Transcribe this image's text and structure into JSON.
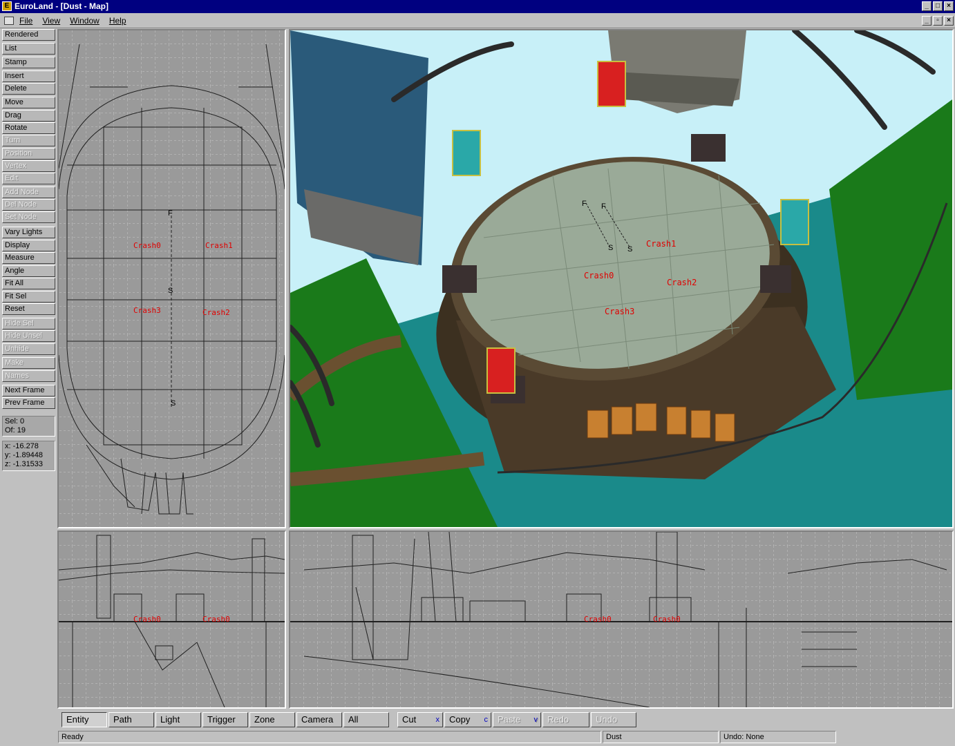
{
  "window": {
    "title": "EuroLand - [Dust - Map]",
    "app_icon": "E",
    "controls": [
      "minimize-icon",
      "maximize-icon",
      "close-icon"
    ]
  },
  "menu": {
    "items": [
      "File",
      "View",
      "Window",
      "Help"
    ]
  },
  "toolbar": {
    "buttons": [
      {
        "label": "Rendered",
        "enabled": true
      },
      {
        "label": "List",
        "enabled": true
      },
      {
        "label": "Stamp",
        "enabled": true
      },
      {
        "label": "Insert",
        "enabled": true
      },
      {
        "label": "Delete",
        "enabled": true
      },
      {
        "label": "Move",
        "enabled": true
      },
      {
        "label": "Drag",
        "enabled": true
      },
      {
        "label": "Rotate",
        "enabled": true
      },
      {
        "label": "Turn",
        "enabled": false
      },
      {
        "label": "Position",
        "enabled": false
      },
      {
        "label": "Vertex",
        "enabled": false
      },
      {
        "label": "Edit",
        "enabled": false
      },
      {
        "label": "Add Node",
        "enabled": false
      },
      {
        "label": "Del Node",
        "enabled": false
      },
      {
        "label": "Set Node",
        "enabled": false
      },
      {
        "label": "Vary Lights",
        "enabled": true
      },
      {
        "label": "Display",
        "enabled": true
      },
      {
        "label": "Measure",
        "enabled": true
      },
      {
        "label": "Angle",
        "enabled": true
      },
      {
        "label": "Fit All",
        "enabled": true
      },
      {
        "label": "Fit Sel",
        "enabled": true
      },
      {
        "label": "Reset",
        "enabled": true
      },
      {
        "label": "Hide Sel",
        "enabled": false
      },
      {
        "label": "Hide Unsel",
        "enabled": false
      },
      {
        "label": "Unhide",
        "enabled": false
      },
      {
        "label": "Make",
        "enabled": false
      },
      {
        "label": "Names",
        "enabled": false
      },
      {
        "label": "Next Frame",
        "enabled": true
      },
      {
        "label": "Prev Frame",
        "enabled": true
      }
    ],
    "selection": {
      "sel": "Sel: 0",
      "of": "Of: 19"
    },
    "coords": {
      "x": "x: -16.278",
      "y": "y: -1.89448",
      "z": "z: -1.31533"
    }
  },
  "viewports": {
    "top": {
      "labels": [
        "Crash0",
        "Crash1",
        "Crash3",
        "Crash2"
      ],
      "path_markers": [
        "F",
        "S",
        "S"
      ]
    },
    "perspective": {
      "labels": [
        "Crash1",
        "Crash0",
        "Crash2",
        "Crash3"
      ],
      "path_markers": [
        "F",
        "F",
        "S",
        "S"
      ]
    },
    "front": {
      "labels": [
        "Crash0",
        "Crash0"
      ]
    },
    "side": {
      "labels": [
        "Crash0",
        "Crash0"
      ]
    }
  },
  "tabs": [
    {
      "label": "Entity",
      "selected": true,
      "enabled": true,
      "key": ""
    },
    {
      "label": "Path",
      "selected": false,
      "enabled": true,
      "key": ""
    },
    {
      "label": "Light",
      "selected": false,
      "enabled": true,
      "key": ""
    },
    {
      "label": "Trigger",
      "selected": false,
      "enabled": true,
      "key": ""
    },
    {
      "label": "Zone",
      "selected": false,
      "enabled": true,
      "key": ""
    },
    {
      "label": "Camera",
      "selected": false,
      "enabled": true,
      "key": ""
    },
    {
      "label": "All",
      "selected": false,
      "enabled": true,
      "key": ""
    },
    {
      "label": "Cut",
      "selected": false,
      "enabled": true,
      "key": "x"
    },
    {
      "label": "Copy",
      "selected": false,
      "enabled": true,
      "key": "c"
    },
    {
      "label": "Paste",
      "selected": false,
      "enabled": false,
      "key": "v"
    },
    {
      "label": "Redo",
      "selected": false,
      "enabled": false,
      "key": ""
    },
    {
      "label": "Undo",
      "selected": false,
      "enabled": false,
      "key": ""
    }
  ],
  "status": {
    "ready": "Ready",
    "map": "Dust",
    "undo": "Undo: None"
  },
  "colors": {
    "titlebar": "#000080",
    "sky": "#c8f0f8",
    "sea": "#1a8a8a",
    "grass": "#1a7a1a",
    "entity_label": "#e00000"
  }
}
